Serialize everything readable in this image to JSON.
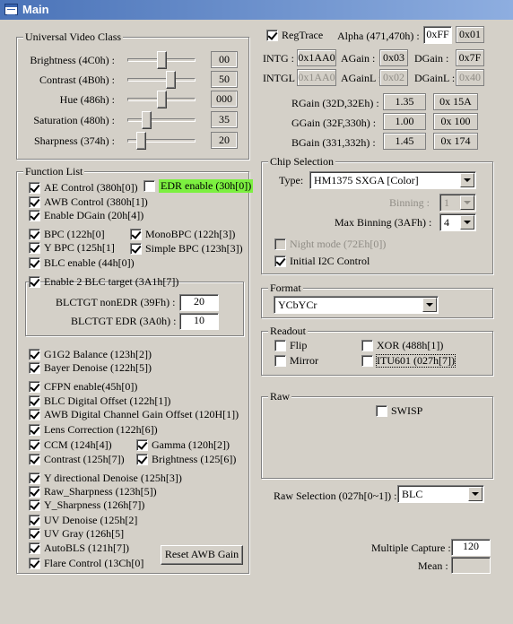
{
  "window": {
    "title": "Main"
  },
  "uvc": {
    "legend": "Universal Video Class",
    "rows": [
      {
        "label": "Brightness (4C0h) :",
        "value": "00",
        "level": 0.5
      },
      {
        "label": "Contrast (4B0h) :",
        "value": "50",
        "level": 0.63
      },
      {
        "label": "Hue (486h) :",
        "value": "000",
        "level": 0.5
      },
      {
        "label": "Saturation (480h) :",
        "value": "35",
        "level": 0.27
      },
      {
        "label": "Sharpness (374h) :",
        "value": "20",
        "level": 0.2
      }
    ]
  },
  "functions": {
    "legend": "Function List",
    "ae_control": "AE Control (380h[0])",
    "edr_enable": "EDR enable (30h[0])",
    "awb_control": "AWB Control (380h[1])",
    "enable_dgain": "Enable DGain (20h[4])",
    "bpc": "BPC (122h[0]",
    "mono_bpc": "MonoBPC (122h[3])",
    "y_bpc": "Y BPC (125h[1]",
    "simple_bpc": "Simple BPC (123h[3])",
    "blc_enable": "BLC enable (44h[0])",
    "blc_target_legend": "Enable 2 BLC target (3A1h[7])",
    "blctgt_non_edr_label": "BLCTGT nonEDR (39Fh) :",
    "blctgt_non_edr_value": "20",
    "blctgt_edr_label": "BLCTGT EDR (3A0h) :",
    "blctgt_edr_value": "10",
    "g1g2_balance": "G1G2 Balance (123h[2])",
    "bayer_denoise": "Bayer Denoise (122h[5])",
    "cfpn_enable": "CFPN enable(45h[0])",
    "blc_digital_offset": "BLC Digital Offset (122h[1])",
    "awb_digital_gain_offset": "AWB Digital Channel Gain Offset (120H[1])",
    "lens_correction": "Lens Correction (122h[6])",
    "ccm": "CCM (124h[4])",
    "gamma": "Gamma (120h[2])",
    "contrast": "Contrast (125h[7])",
    "brightness": "Brightness (125[6])",
    "y_directional_denoise": "Y directional Denoise (125h[3])",
    "raw_sharpness": "Raw_Sharpness (123h[5])",
    "y_sharpness": "Y_Sharpness (126h[7])",
    "uv_denoise": "UV Denoise (125h[2]",
    "uv_gray": "UV Gray (126h[5]",
    "auto_bls": "AutoBLS (121h[7])",
    "flare_control": "Flare Control (13Ch[0]",
    "reset_awb_gain": "Reset AWB Gain"
  },
  "regtrace": {
    "label": "RegTrace",
    "alpha_label": "Alpha (471,470h) :",
    "alpha_button": "0xFF",
    "alpha_value": "0x01",
    "intg_label": "INTG :",
    "intg_value": "0x1AA0",
    "again_label": "AGain :",
    "again_value": "0x03",
    "dgain_label": "DGain :",
    "dgain_value": "0x7F",
    "intgl_label": "INTGL",
    "intgl_value": "0x1AA0",
    "againl_label": "AGainL :",
    "againl_value": "0x02",
    "dgainl_label": "DGainL :",
    "dgainl_value": "0x40",
    "rgain_label": "RGain (32D,32Eh) :",
    "rgain_value": "1.35",
    "rgain_hex": "0x 15A",
    "ggain_label": "GGain (32F,330h) :",
    "ggain_value": "1.00",
    "ggain_hex": "0x 100",
    "bgain_label": "BGain (331,332h) :",
    "bgain_value": "1.45",
    "bgain_hex": "0x 174"
  },
  "chip": {
    "legend": "Chip Selection",
    "type_label": "Type:",
    "type_value": "HM1375 SXGA [Color]",
    "binning_label": "Binning :",
    "binning_value": "1",
    "max_binning_label": "Max Binning (3AFh) :",
    "max_binning_value": "4",
    "night_mode": "Night mode (72Eh[0])",
    "initial_i2c": "Initial I2C Control"
  },
  "format": {
    "legend": "Format",
    "value": "YCbYCr"
  },
  "readout": {
    "legend": "Readout",
    "flip": "Flip",
    "mirror": "Mirror",
    "xor": "XOR (488h[1])",
    "itu601": "ITU601 (027h[7])"
  },
  "raw": {
    "legend": "Raw",
    "swisp": "SWISP",
    "selection_label": "Raw Selection (027h[0~1]) :",
    "selection_value": "BLC"
  },
  "capture": {
    "multiple_label": "Multiple Capture :",
    "multiple_value": "120",
    "mean_label": "Mean :",
    "mean_value": ""
  }
}
